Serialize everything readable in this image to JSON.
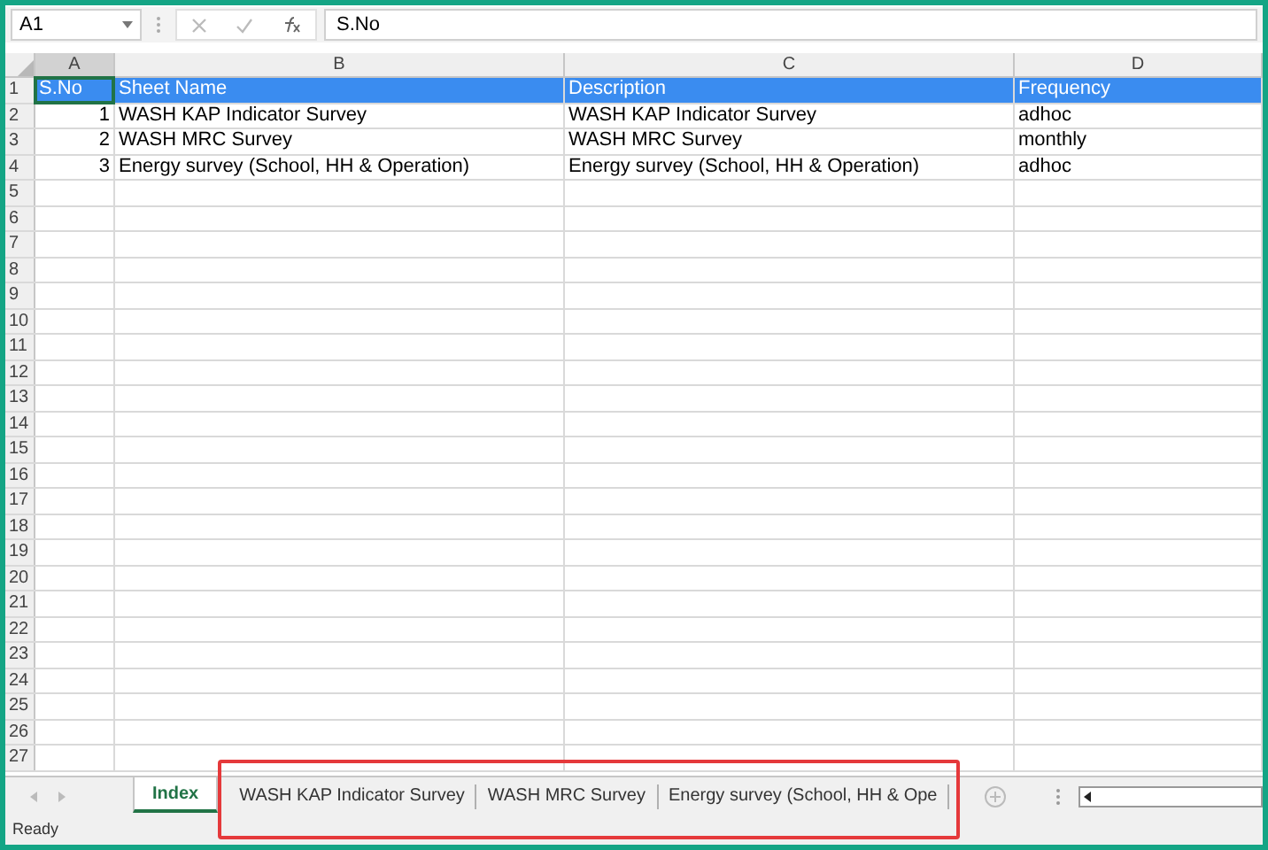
{
  "formula_bar": {
    "name_box": "A1",
    "formula": "S.No"
  },
  "columns": [
    "A",
    "B",
    "C",
    "D"
  ],
  "rows": [
    {
      "number": "1",
      "highlighted": true,
      "cells": [
        {
          "text": "S.No",
          "selected": true
        },
        {
          "text": "Sheet Name",
          "selected": false
        },
        {
          "text": "Description",
          "selected": false
        },
        {
          "text": "Frequency",
          "selected": false
        }
      ]
    },
    {
      "number": "2",
      "highlighted": false,
      "cells": [
        {
          "text": "1",
          "selected": false
        },
        {
          "text": "WASH KAP Indicator Survey",
          "selected": false
        },
        {
          "text": "WASH KAP Indicator Survey",
          "selected": false
        },
        {
          "text": "adhoc",
          "selected": false
        }
      ]
    },
    {
      "number": "3",
      "highlighted": false,
      "cells": [
        {
          "text": "2",
          "selected": false
        },
        {
          "text": "WASH MRC Survey",
          "selected": false
        },
        {
          "text": "WASH MRC Survey",
          "selected": false
        },
        {
          "text": "monthly",
          "selected": false
        }
      ]
    },
    {
      "number": "4",
      "highlighted": false,
      "cells": [
        {
          "text": "3",
          "selected": false
        },
        {
          "text": "Energy survey (School, HH & Operation)",
          "selected": false
        },
        {
          "text": "Energy survey (School, HH & Operation)",
          "selected": false
        },
        {
          "text": "adhoc",
          "selected": false
        }
      ]
    },
    {
      "number": "5"
    },
    {
      "number": "6"
    },
    {
      "number": "7"
    },
    {
      "number": "8"
    },
    {
      "number": "9"
    },
    {
      "number": "10"
    },
    {
      "number": "11"
    },
    {
      "number": "12"
    },
    {
      "number": "13"
    },
    {
      "number": "14"
    },
    {
      "number": "15"
    },
    {
      "number": "16"
    },
    {
      "number": "17"
    },
    {
      "number": "18"
    },
    {
      "number": "19"
    },
    {
      "number": "20"
    },
    {
      "number": "21"
    },
    {
      "number": "22"
    },
    {
      "number": "23"
    },
    {
      "number": "24"
    },
    {
      "number": "25"
    },
    {
      "number": "26"
    },
    {
      "number": "27"
    }
  ],
  "sheet_tabs": [
    {
      "label": "Index",
      "selected": true
    },
    {
      "label": "WASH KAP Indicator Survey",
      "selected": false
    },
    {
      "label": "WASH MRC Survey",
      "selected": false
    },
    {
      "label": "Energy survey (School, HH & Ope",
      "selected": false
    }
  ],
  "tab_highlight_frame": true,
  "status_bar": {
    "text": "Ready"
  }
}
